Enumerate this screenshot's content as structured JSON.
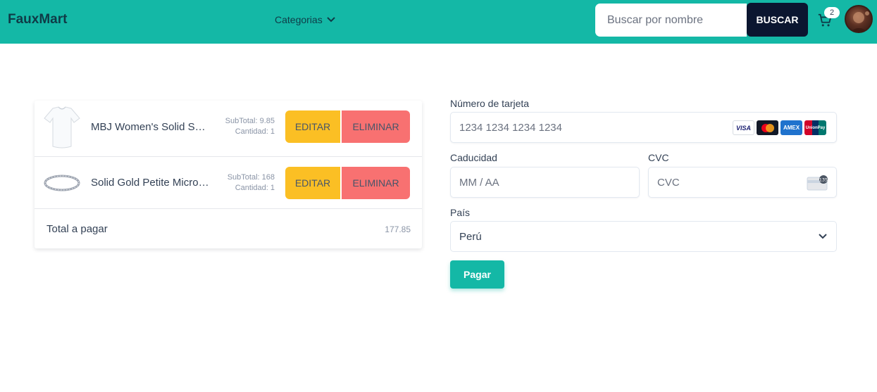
{
  "header": {
    "brand": "FauxMart",
    "categories_label": "Categorias",
    "search_placeholder": "Buscar por nombre",
    "search_button": "BUSCAR",
    "cart_count": "2"
  },
  "cart": {
    "items": [
      {
        "name": "MBJ Women's Solid Short Sleeve Boat Neck V",
        "subtotal": "SubTotal: 9.85",
        "quantity": "Cantidad: 1",
        "image": "white-tshirt"
      },
      {
        "name": "Solid Gold Petite Micropave",
        "subtotal": "SubTotal: 168",
        "quantity": "Cantidad: 1",
        "image": "silver-ring"
      }
    ],
    "edit_label": "EDITAR",
    "delete_label": "ELIMINAR",
    "total_label": "Total a pagar",
    "total_value": "177.85"
  },
  "payment": {
    "card_number_label": "Número de tarjeta",
    "card_number_placeholder": "1234 1234 1234 1234",
    "expiry_label": "Caducidad",
    "expiry_placeholder": "MM / AA",
    "cvc_label": "CVC",
    "cvc_placeholder": "CVC",
    "cvc_icon_text": "135",
    "country_label": "País",
    "country_value": "Perú",
    "pay_button": "Pagar",
    "card_brands": [
      "VISA",
      "mastercard",
      "AMEX",
      "UnionPay"
    ]
  },
  "colors": {
    "header_bg": "#14b8a6",
    "search_button_bg": "#0b1630",
    "edit_bg": "#fbbf24",
    "delete_bg": "#f87171",
    "pay_bg": "#14b8a6"
  }
}
